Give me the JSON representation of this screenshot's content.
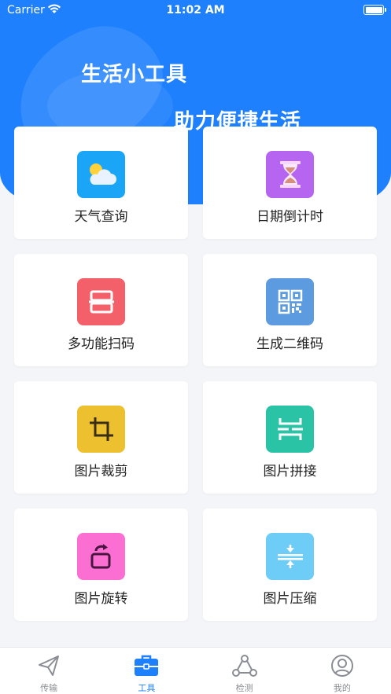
{
  "status_bar": {
    "carrier": "Carrier",
    "time": "11:02 AM"
  },
  "hero": {
    "title": "生活小工具",
    "subtitle": "助力便捷生活"
  },
  "tools": [
    {
      "label": "天气查询",
      "icon": "weather-icon",
      "color": "#1aa5f6"
    },
    {
      "label": "日期倒计时",
      "icon": "hourglass-icon",
      "color": "#b565f0"
    },
    {
      "label": "多功能扫码",
      "icon": "scan-icon",
      "color": "#f3606a"
    },
    {
      "label": "生成二维码",
      "icon": "qr-code-icon",
      "color": "#5c9be0"
    },
    {
      "label": "图片裁剪",
      "icon": "crop-icon",
      "color": "#ecc02f"
    },
    {
      "label": "图片拼接",
      "icon": "stitch-icon",
      "color": "#2bc3a6"
    },
    {
      "label": "图片旋转",
      "icon": "rotate-icon",
      "color": "#fb6fd2"
    },
    {
      "label": "图片压缩",
      "icon": "compress-icon",
      "color": "#6ecdf7"
    }
  ],
  "tabbar": {
    "active_color": "#1f80fd",
    "inactive_color": "#8a8d93",
    "items": [
      {
        "label": "传输",
        "icon": "send-icon"
      },
      {
        "label": "工具",
        "icon": "toolbox-icon"
      },
      {
        "label": "检测",
        "icon": "detect-icon"
      },
      {
        "label": "我的",
        "icon": "profile-icon"
      }
    ]
  }
}
